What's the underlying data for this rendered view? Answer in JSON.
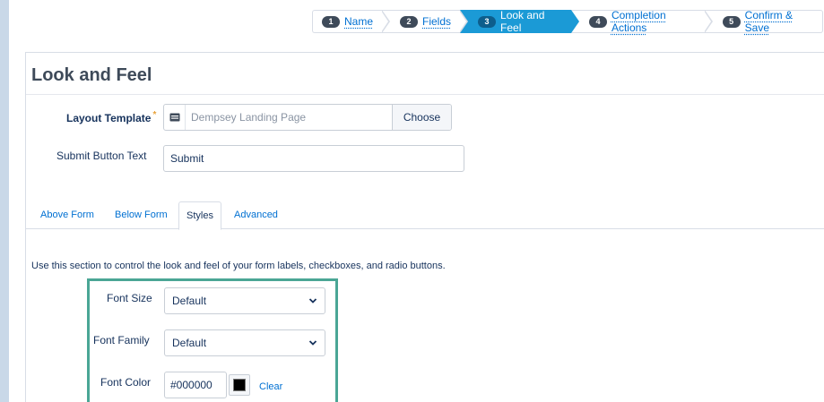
{
  "wizard": {
    "steps": [
      {
        "num": "1",
        "label": "Name"
      },
      {
        "num": "2",
        "label": "Fields"
      },
      {
        "num": "3",
        "label": "Look and Feel"
      },
      {
        "num": "4",
        "label": "Completion Actions"
      },
      {
        "num": "5",
        "label": "Confirm & Save"
      }
    ],
    "active_step": 3
  },
  "page": {
    "title": "Look and Feel"
  },
  "form": {
    "layout_template_label": "Layout Template",
    "layout_template_placeholder": "Dempsey Landing Page",
    "choose_label": "Choose",
    "submit_text_label": "Submit Button Text",
    "submit_text_value": "Submit"
  },
  "tabs": [
    {
      "label": "Above Form"
    },
    {
      "label": "Below Form"
    },
    {
      "label": "Styles"
    },
    {
      "label": "Advanced"
    }
  ],
  "active_tab": "Styles",
  "styles": {
    "help_text": "Use this section to control the look and feel of your form labels, checkboxes, and radio buttons.",
    "font_size_label": "Font Size",
    "font_size_value": "Default",
    "font_family_label": "Font Family",
    "font_family_value": "Default",
    "font_color_label": "Font Color",
    "font_color_value": "#000000",
    "clear_label": "Clear"
  },
  "colors": {
    "accent": "#1b9ad6",
    "link": "#0070d2",
    "highlight_border": "#4aa695",
    "required": "#e8a23a"
  },
  "icons": {
    "template": "layout-template-icon",
    "select": "chevron-down-icon",
    "color": "color-swatch-icon"
  }
}
